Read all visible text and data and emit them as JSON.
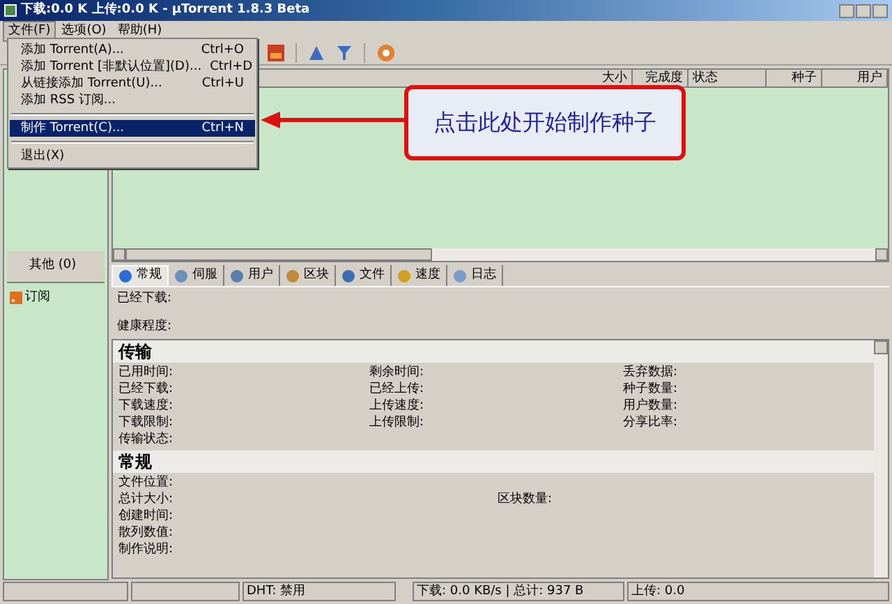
{
  "title_bar": {
    "title": "下载:0.0 K 上传:0.0 K - µTorrent 1.8.3 Beta"
  },
  "menu_bar": [
    {
      "label": "文件(F)",
      "selected": true
    },
    {
      "label": "选项(O)",
      "selected": false
    },
    {
      "label": "帮助(H)",
      "selected": false
    }
  ],
  "file_menu": [
    {
      "kind": "item",
      "label": "添加 Torrent(A)...",
      "shortcut": "Ctrl+O",
      "selected": false
    },
    {
      "kind": "item",
      "label": "添加 Torrent [非默认位置](D)...",
      "shortcut": "Ctrl+D",
      "selected": false
    },
    {
      "kind": "item",
      "label": "从链接添加 Torrent(U)...",
      "shortcut": "Ctrl+U",
      "selected": false
    },
    {
      "kind": "item",
      "label": "添加 RSS 订阅...",
      "selected": false
    },
    {
      "kind": "separator"
    },
    {
      "kind": "item",
      "label": "制作 Torrent(C)...",
      "shortcut": "Ctrl+N",
      "selected": true
    },
    {
      "kind": "separator"
    },
    {
      "kind": "item",
      "label": "退出(X)",
      "selected": false
    }
  ],
  "sidebar": [
    {
      "kind": "header",
      "label": "其他 (0)"
    },
    {
      "kind": "feed",
      "label": "订阅"
    }
  ],
  "torrent_list": {
    "columns": [
      "大小",
      "完成度",
      "状态",
      "种子",
      "用户"
    ]
  },
  "callout": {
    "text": "点击此处开始制作种子"
  },
  "tabs": [
    {
      "label": "常规",
      "selected": true
    },
    {
      "label": "伺服",
      "selected": false
    },
    {
      "label": "用户",
      "selected": false
    },
    {
      "label": "区块",
      "selected": false
    },
    {
      "label": "文件",
      "selected": false
    },
    {
      "label": "速度",
      "selected": false
    },
    {
      "label": "日志",
      "selected": false
    }
  ],
  "summary": [
    "已经下载:",
    "健康程度:"
  ],
  "sections": [
    {
      "title": "传输",
      "kind": "three_column",
      "rows": [
        {
          "col_1": "已用时间:",
          "col_2": "剩余时间:",
          "col_3": "丢弃数据:"
        },
        {
          "col_1": "已经下载:",
          "col_2": "已经上传:",
          "col_3": "种子数量:"
        },
        {
          "col_1": "下载速度:",
          "col_2": "上传速度:",
          "col_3": "用户数量:"
        },
        {
          "col_1": "下载限制:",
          "col_2": "上传限制:",
          "col_3": "分享比率:"
        },
        {
          "col_1": "传输状态:"
        }
      ]
    },
    {
      "title": "常规",
      "kind": "two_column",
      "rows": [
        {
          "col_1": "文件位置:"
        },
        {
          "col_1": "总计大小:",
          "col_2": "区块数量:"
        },
        {
          "col_1": "创建时间:"
        },
        {
          "col_1": "散列数值:"
        },
        {
          "col_1": "制作说明:"
        }
      ]
    }
  ],
  "status_bar": [
    "DHT: 禁用",
    "下载: 0.0 KB/s | 总计: 937 B",
    "上传: 0.0"
  ]
}
